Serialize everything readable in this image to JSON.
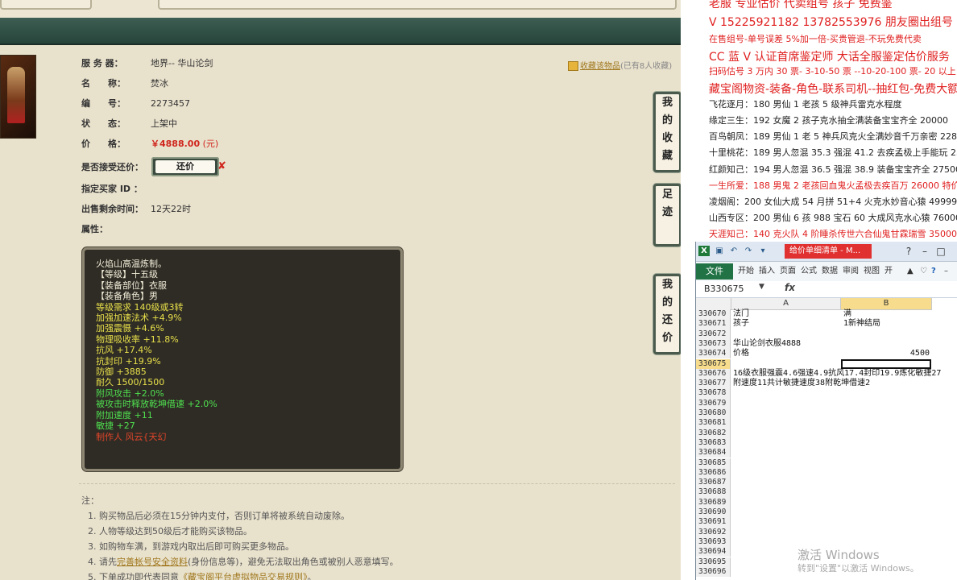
{
  "item": {
    "server_label": "服 务 器：",
    "server_value": "地界-- 华山论剑",
    "name_label": "名　　称：",
    "name_value": "焚冰",
    "id_label": "编　　号：",
    "id_value": "2273457",
    "status_label": "状　　态：",
    "status_value": "上架中",
    "price_label": "价　　格：",
    "price_value": "￥4888.00",
    "price_unit": "(元)",
    "offer_label": "是否接受还价：",
    "offer_button": "还价",
    "offer_x": "✘",
    "buyer_label": "指定买家 ID ：",
    "remain_label": "出售剩余时间：",
    "remain_value": "12天22时",
    "attr_label": "属性："
  },
  "favorite": {
    "link": "收藏该物品",
    "count": "(已有8人收藏)"
  },
  "attributes": [
    {
      "text": "火焰山高温炼制。",
      "color": "#f1ecd8"
    },
    {
      "text": "【等级】十五级",
      "color": "#f1ecd8"
    },
    {
      "text": "【装备部位】衣服",
      "color": "#f1ecd8"
    },
    {
      "text": "【装备角色】男",
      "color": "#f1ecd8"
    },
    {
      "text": "等级需求 140级或3转",
      "color": "#e8e04a"
    },
    {
      "text": "加强加速法术 +4.9%",
      "color": "#e8e04a"
    },
    {
      "text": "加强震慑 +4.6%",
      "color": "#e8e04a"
    },
    {
      "text": "物理吸收率 +11.8%",
      "color": "#e8e04a"
    },
    {
      "text": "抗风 +17.4%",
      "color": "#e8e04a"
    },
    {
      "text": "抗封印 +19.9%",
      "color": "#e8e04a"
    },
    {
      "text": "防御 +3885",
      "color": "#e8e04a"
    },
    {
      "text": "耐久 1500/1500",
      "color": "#e8e04a"
    },
    {
      "text": "附风攻击 +2.0%",
      "color": "#4fe04f"
    },
    {
      "text": "被攻击时释放乾坤借速 +2.0%",
      "color": "#4fe04f"
    },
    {
      "text": "附加速度 +11",
      "color": "#4fe04f"
    },
    {
      "text": "敏捷 +27",
      "color": "#4fe04f"
    },
    {
      "text": "制作人 风云{天幻",
      "color": "#e0452a"
    }
  ],
  "side_tabs": [
    {
      "chars": [
        "我",
        "的",
        "收",
        "藏"
      ]
    },
    {
      "chars": [
        "足",
        "迹"
      ]
    },
    {
      "chars": [
        "我",
        "的",
        "还",
        "价"
      ]
    }
  ],
  "notes": {
    "title": "注：",
    "n1": "1. 购买物品后必须在15分钟内支付，否则订单将被系统自动废除。",
    "n2": "2. 人物等级达到50级后才能购买该物品。",
    "n3": "3. 如购物车满，到游戏内取出后即可购买更多物品。",
    "n4_pre": "4. 请先",
    "n4_link": "完善帐号安全资料",
    "n4_post": "(身份信息等)，避免无法取出角色或被别人恶意填写。",
    "n5_pre": "5. 下单成功即代表同意",
    "n5_link": "《藏宝阁平台虚拟物品交易规则》",
    "n5_post": "。"
  },
  "ad_lines": [
    {
      "text": "老服 专业估价 代卖组号 孩子 免费鉴",
      "color": "#e02020",
      "big": true
    },
    {
      "text": "V 15225921182   13782553976 朋友圈出组号",
      "color": "#e02020",
      "big": true
    },
    {
      "text": "在售组号-单号误差 5%加一倍-买贵管退-不玩免费代卖",
      "color": "#e02020",
      "big": false
    },
    {
      "text": "CC 蓝 V 认证首席鉴定师 大话全服鉴定估价服务",
      "color": "#e02020",
      "big": true
    },
    {
      "text": "扫码估号 3 万内 30 票- 3-10-50 票 --10-20-100 票- 20 以上 150",
      "color": "#e02020",
      "big": false
    },
    {
      "text": "藏宝阁物资-装备-角色-联系司机--抽红包-免费大额支",
      "color": "#e02020",
      "big": true
    },
    {
      "text": "飞花逐月：180 男仙 1 老孩 5 级神兵雷克水程度",
      "color": "#222",
      "big": false
    },
    {
      "text": "缘定三生：192 女魔 2 孩子克水抽全满装备宝宝齐全 20000",
      "color": "#222",
      "big": false
    },
    {
      "text": "百鸟朝凤：189 男仙 1 老 5 神兵风克火全满妙音千万亲密 228",
      "color": "#222",
      "big": false
    },
    {
      "text": "十里桃花：189 男人忽混 35.3 强混 41.2 去疾孟极上手能玩 25",
      "color": "#222",
      "big": false
    },
    {
      "text": "红颜知己：194 男人忽混 36.5 强混 38.9 装备宝宝齐全 27500",
      "color": "#222",
      "big": false
    },
    {
      "text": "一生所爱：188 男鬼 2 老孩回血鬼火孟极去疾百万 26000 特价",
      "color": "#e02020",
      "big": false
    },
    {
      "text": "凌烟阁：200 女仙大成 54 月拼 51+4 火克水妙音心猿 49999",
      "color": "#222",
      "big": false
    },
    {
      "text": "山西专区：200 男仙 6 孩 988 宝石 60 大成风克水心猿 76000",
      "color": "#222",
      "big": false
    },
    {
      "text": "天涯知己：140 克火队 4 阶睡杀传世六合仙鬼甘霖瑞雪 35000",
      "color": "#e02020",
      "big": false
    }
  ],
  "excel": {
    "doc_title": "给价单细清单 - M...",
    "ribbon": {
      "file": "文件",
      "tabs": [
        "开始",
        "插入",
        "页面",
        "公式",
        "数据",
        "审阅",
        "视图",
        "开"
      ]
    },
    "name_box": "B330675",
    "fx": "fx",
    "col_a": "A",
    "col_b": "B",
    "rows": [
      {
        "num": "330670",
        "a": "法门",
        "b": "满"
      },
      {
        "num": "330671",
        "a": "孩子",
        "b": "1新神结局"
      },
      {
        "num": "330672",
        "a": "",
        "b": ""
      },
      {
        "num": "330673",
        "a": "华山论剑衣服4888",
        "b": ""
      },
      {
        "num": "330674",
        "a": "价格",
        "b": "4500"
      },
      {
        "num": "330675",
        "a": "",
        "b": ""
      },
      {
        "num": "330676",
        "a": "16级衣服强震4.6强速4.9抗风17.4封印19.9炼化敏捷27",
        "b": ""
      },
      {
        "num": "330677",
        "a": "附速度11共计敏捷速度38附乾坤借速2",
        "b": ""
      },
      {
        "num": "330678",
        "a": "",
        "b": ""
      },
      {
        "num": "330679",
        "a": "",
        "b": ""
      },
      {
        "num": "330680",
        "a": "",
        "b": ""
      },
      {
        "num": "330681",
        "a": "",
        "b": ""
      },
      {
        "num": "330682",
        "a": "",
        "b": ""
      },
      {
        "num": "330683",
        "a": "",
        "b": ""
      },
      {
        "num": "330684",
        "a": "",
        "b": ""
      },
      {
        "num": "330685",
        "a": "",
        "b": ""
      },
      {
        "num": "330686",
        "a": "",
        "b": ""
      },
      {
        "num": "330687",
        "a": "",
        "b": ""
      },
      {
        "num": "330688",
        "a": "",
        "b": ""
      },
      {
        "num": "330689",
        "a": "",
        "b": ""
      },
      {
        "num": "330690",
        "a": "",
        "b": ""
      },
      {
        "num": "330691",
        "a": "",
        "b": ""
      },
      {
        "num": "330692",
        "a": "",
        "b": ""
      },
      {
        "num": "330693",
        "a": "",
        "b": ""
      },
      {
        "num": "330694",
        "a": "",
        "b": ""
      },
      {
        "num": "330695",
        "a": "",
        "b": ""
      },
      {
        "num": "330696",
        "a": "",
        "b": ""
      }
    ]
  },
  "watermark": {
    "line1": "激活 Windows",
    "line2": "转到\"设置\"以激活 Windows。"
  }
}
